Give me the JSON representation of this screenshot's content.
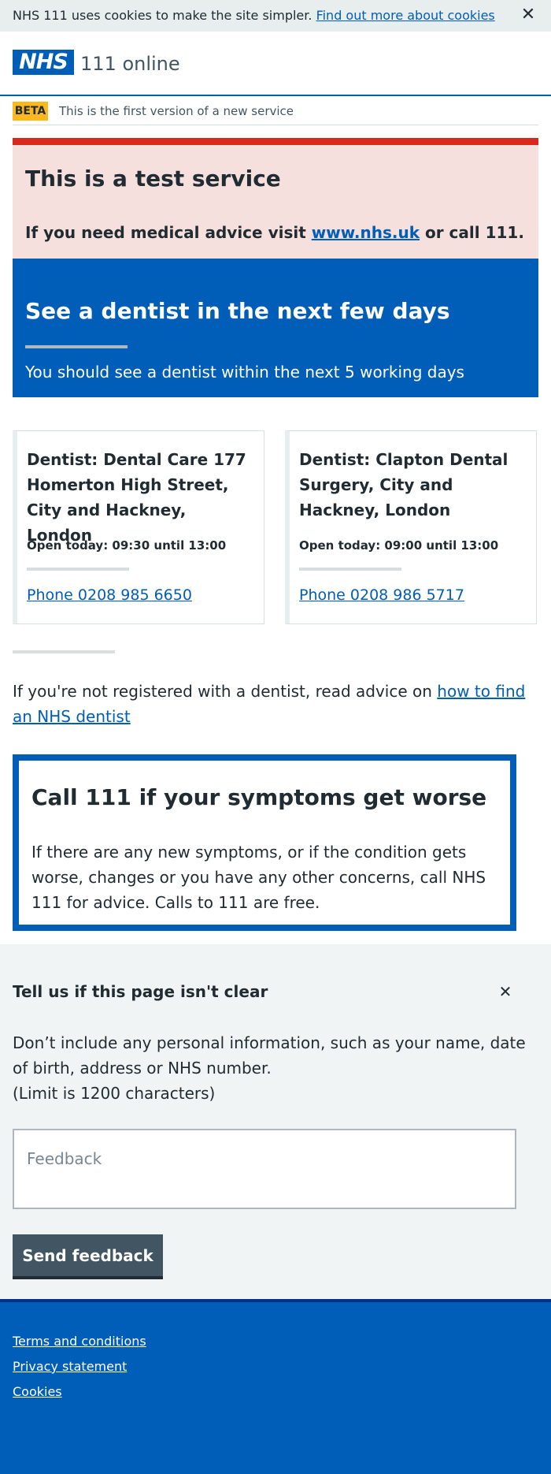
{
  "cookie_banner": {
    "text": "NHS 111 uses cookies to make the site simpler.",
    "link_text": "Find out more about cookies",
    "close_glyph": "✕"
  },
  "header": {
    "logo": "NHS",
    "service_name": "111 online"
  },
  "beta": {
    "tag": "BETA",
    "text": "This is the first version of a new service"
  },
  "test_alert": {
    "title": "This is a test service",
    "body_before": "If you need medical advice visit",
    "link_text": "www.nhs.uk",
    "body_after": "or call 111."
  },
  "hero": {
    "title": "See a dentist in the next few days",
    "subtitle": "You should see a dentist within the next 5 working days"
  },
  "dentists": [
    {
      "name": "Dentist: Dental Care 177 Homerton High Street, City and Hackney, London",
      "hours": "Open today: 09:30 until 13:00",
      "phone": "Phone 0208 985 6650"
    },
    {
      "name": "Dentist: Clapton Dental Surgery, City and Hackney, London",
      "hours": "Open today: 09:00 until 13:00",
      "phone": "Phone 0208 986 5717"
    }
  ],
  "advice": {
    "text": "If you're not registered with a dentist, read advice on",
    "link_text": "how to find an NHS dentist"
  },
  "care_card": {
    "title": "Call 111 if your symptoms get worse",
    "body": "If there are any new symptoms, or if the condition gets worse, changes or you have any other concerns, call NHS 111 for advice. Calls to 111 are free."
  },
  "feedback": {
    "title": "Tell us if this page isn't clear",
    "close_glyph": "✕",
    "hint": "Don’t include any personal information, such as your name, date of birth, address or NHS number.",
    "limit": "(Limit is 1200 characters)",
    "placeholder": "Feedback",
    "button": "Send feedback"
  },
  "footer": {
    "links": [
      "Terms and conditions",
      "Privacy statement",
      "Cookies"
    ]
  },
  "colors": {
    "nhs_blue": "#005eb8",
    "alert_red": "#da291c",
    "beta_yellow": "#ffb81c",
    "text": "#212b32"
  }
}
